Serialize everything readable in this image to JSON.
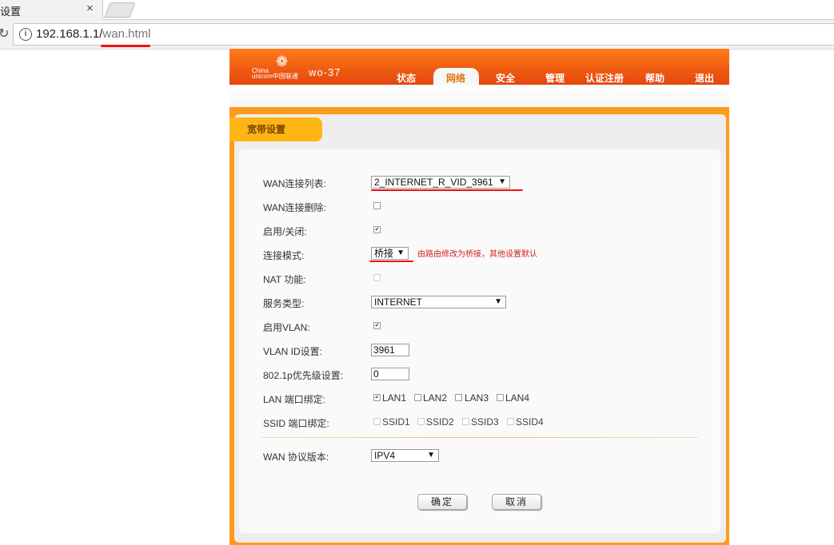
{
  "browser": {
    "tab_title": "设置",
    "tab_close": "×",
    "url_host": "192.168.1.1/",
    "url_path": "wan.html"
  },
  "router": {
    "logo_china": "China",
    "logo_unicom": "unicom中国联通",
    "model": "wo-37",
    "nav": [
      "状态",
      "网络",
      "安全",
      "管理",
      "认证注册",
      "帮助",
      "退出"
    ],
    "active_nav": "网络",
    "section_title": "宽带设置"
  },
  "form": {
    "wan_list_label": "WAN连接列表:",
    "wan_list_value": "2_INTERNET_R_VID_3961",
    "wan_delete_label": "WAN连接删除:",
    "wan_delete_checked": false,
    "enable_label": "启用/关闭:",
    "enable_checked": true,
    "mode_label": "连接模式:",
    "mode_value": "桥接",
    "mode_note": "由路由修改为桥接，其他设置默认",
    "nat_label": "NAT 功能:",
    "nat_checked": false,
    "service_label": "服务类型:",
    "service_value": "INTERNET",
    "vlan_enable_label": "启用VLAN:",
    "vlan_enable_checked": true,
    "vlan_id_label": "VLAN ID设置:",
    "vlan_id_value": "3961",
    "priority_label": "802.1p优先级设置:",
    "priority_value": "0",
    "lan_bind_label": "LAN 端口绑定:",
    "lan_ports": [
      {
        "label": "LAN1",
        "checked": true
      },
      {
        "label": "LAN2",
        "checked": false
      },
      {
        "label": "LAN3",
        "checked": false
      },
      {
        "label": "LAN4",
        "checked": false
      }
    ],
    "ssid_bind_label": "SSID 端口绑定:",
    "ssids": [
      {
        "label": "SSID1",
        "checked": false
      },
      {
        "label": "SSID2",
        "checked": false
      },
      {
        "label": "SSID3",
        "checked": false
      },
      {
        "label": "SSID4",
        "checked": false
      }
    ],
    "protocol_label": "WAN 协议版本:",
    "protocol_value": "IPV4",
    "confirm_label": "确定",
    "cancel_label": "取消"
  },
  "colors": {
    "header_orange": "#e4460c",
    "frame_orange": "#ff9a1e",
    "section_tab": "#ffb514",
    "annotation_red": "#ee1111"
  }
}
